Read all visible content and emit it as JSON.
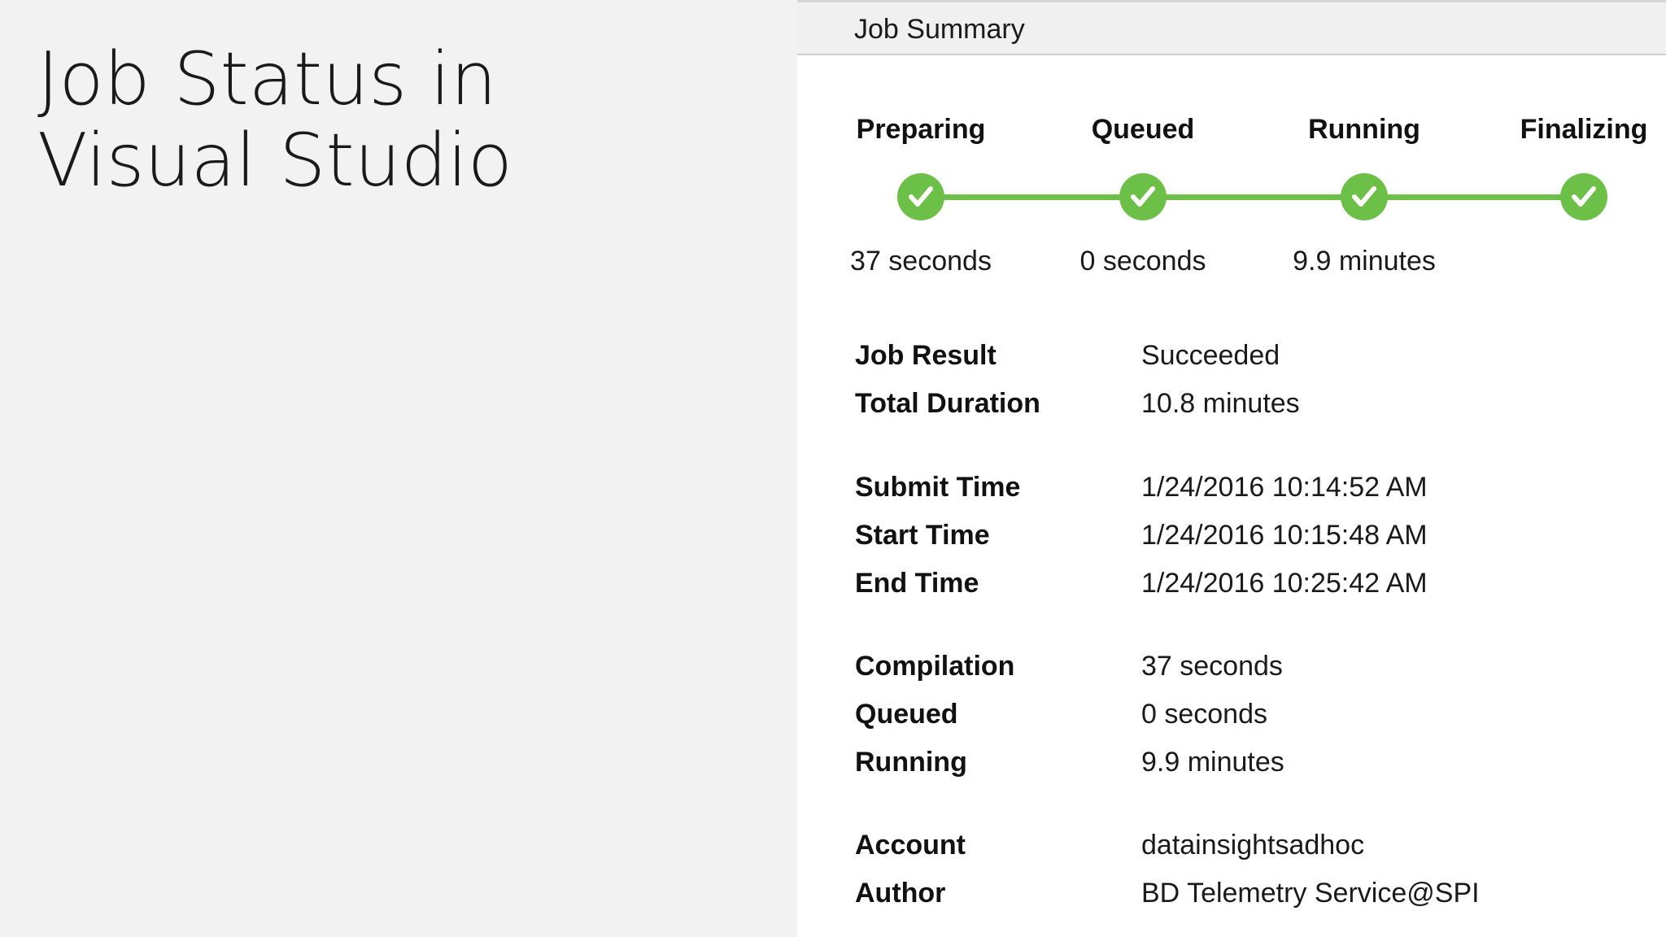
{
  "slide": {
    "title_line1": "Job Status in",
    "title_line2": "Visual Studio"
  },
  "panel": {
    "header_title": "Job Summary",
    "accent_color": "#6cbf47",
    "stages": [
      {
        "name": "Preparing",
        "duration": "37 seconds",
        "icon": "check-icon",
        "completed": true
      },
      {
        "name": "Queued",
        "duration": "0 seconds",
        "icon": "check-icon",
        "completed": true
      },
      {
        "name": "Running",
        "duration": "9.9 minutes",
        "icon": "check-icon",
        "completed": true
      },
      {
        "name": "Finalizing",
        "duration": "",
        "icon": "check-icon",
        "completed": true
      }
    ],
    "details": {
      "job_result": {
        "label": "Job Result",
        "value": "Succeeded"
      },
      "total_duration": {
        "label": "Total Duration",
        "value": "10.8 minutes"
      },
      "submit_time": {
        "label": "Submit Time",
        "value": "1/24/2016 10:14:52 AM"
      },
      "start_time": {
        "label": "Start Time",
        "value": "1/24/2016 10:15:48 AM"
      },
      "end_time": {
        "label": "End Time",
        "value": "1/24/2016 10:25:42 AM"
      },
      "compilation": {
        "label": "Compilation",
        "value": "37 seconds"
      },
      "queued": {
        "label": "Queued",
        "value": "0 seconds"
      },
      "running": {
        "label": "Running",
        "value": "9.9 minutes"
      },
      "account": {
        "label": "Account",
        "value": "datainsightsadhoc"
      },
      "author": {
        "label": "Author",
        "value": "BD Telemetry Service@SPI"
      }
    }
  }
}
